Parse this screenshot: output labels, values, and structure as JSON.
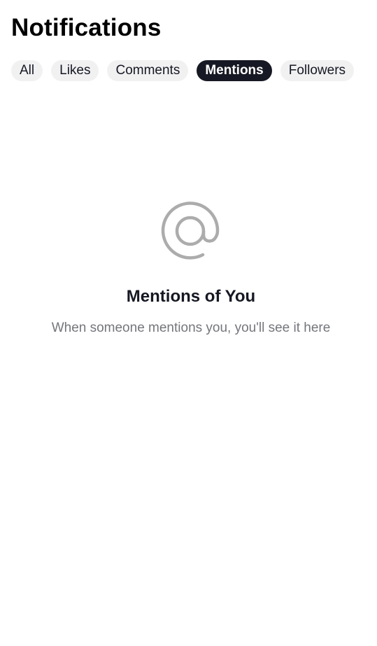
{
  "header": {
    "title": "Notifications"
  },
  "tabs": [
    {
      "label": "All",
      "active": false
    },
    {
      "label": "Likes",
      "active": false
    },
    {
      "label": "Comments",
      "active": false
    },
    {
      "label": "Mentions",
      "active": true
    },
    {
      "label": "Followers",
      "active": false
    }
  ],
  "empty_state": {
    "icon": "at-sign-icon",
    "title": "Mentions of You",
    "subtitle": "When someone mentions you, you'll see it here"
  },
  "colors": {
    "text_primary": "#161823",
    "text_secondary": "#75767c",
    "tab_background": "#f1f1f2",
    "tab_active_background": "#161823",
    "icon_gray": "#acacac"
  }
}
